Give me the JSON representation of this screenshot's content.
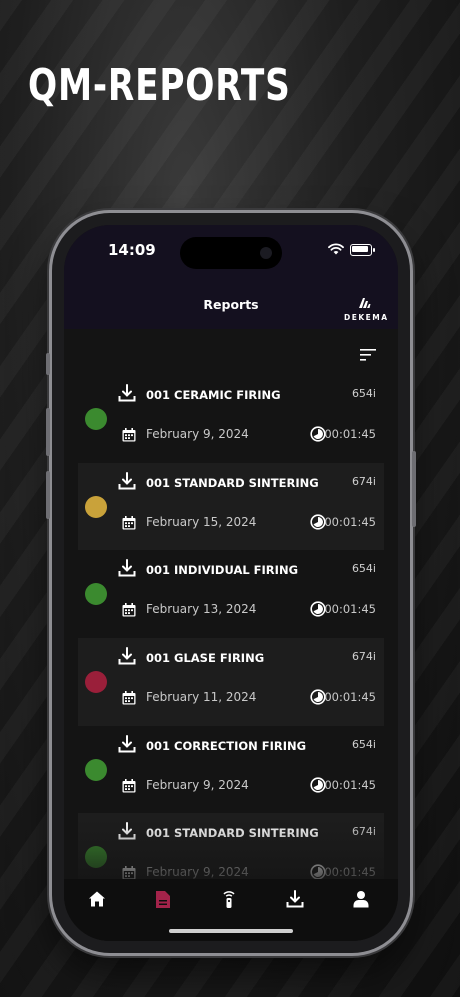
{
  "promo": {
    "title": "QM-REPORTS"
  },
  "status_bar": {
    "time": "14:09"
  },
  "header": {
    "title": "Reports",
    "logo_text": "DEKEMA"
  },
  "reports": [
    {
      "name": "001 CERAMIC FIRING",
      "code": "654i",
      "date": "February 9, 2024",
      "duration": "00:01:45",
      "status_color": "#3b8a2f"
    },
    {
      "name": "001 STANDARD SINTERING",
      "code": "674i",
      "date": "February 15, 2024",
      "duration": "00:01:45",
      "status_color": "#c9a23a"
    },
    {
      "name": "001 INDIVIDUAL FIRING",
      "code": "654i",
      "date": "February 13, 2024",
      "duration": "00:01:45",
      "status_color": "#3b8a2f"
    },
    {
      "name": "001 GLASE FIRING",
      "code": "674i",
      "date": "February 11, 2024",
      "duration": "00:01:45",
      "status_color": "#9a1f3a"
    },
    {
      "name": "001 CORRECTION FIRING",
      "code": "654i",
      "date": "February 9, 2024",
      "duration": "00:01:45",
      "status_color": "#3b8a2f"
    },
    {
      "name": "001 STANDARD SINTERING",
      "code": "674i",
      "date": "February 9, 2024",
      "duration": "00:01:45",
      "status_color": "#3b8a2f"
    }
  ],
  "tabs": [
    {
      "icon": "home-icon",
      "active": false
    },
    {
      "icon": "document-icon",
      "active": true
    },
    {
      "icon": "remote-icon",
      "active": false
    },
    {
      "icon": "download-icon",
      "active": false
    },
    {
      "icon": "user-icon",
      "active": false
    }
  ],
  "colors": {
    "active_tab": "#a3234a",
    "inactive_tab": "#ffffff",
    "nav_background": "#14101f"
  }
}
